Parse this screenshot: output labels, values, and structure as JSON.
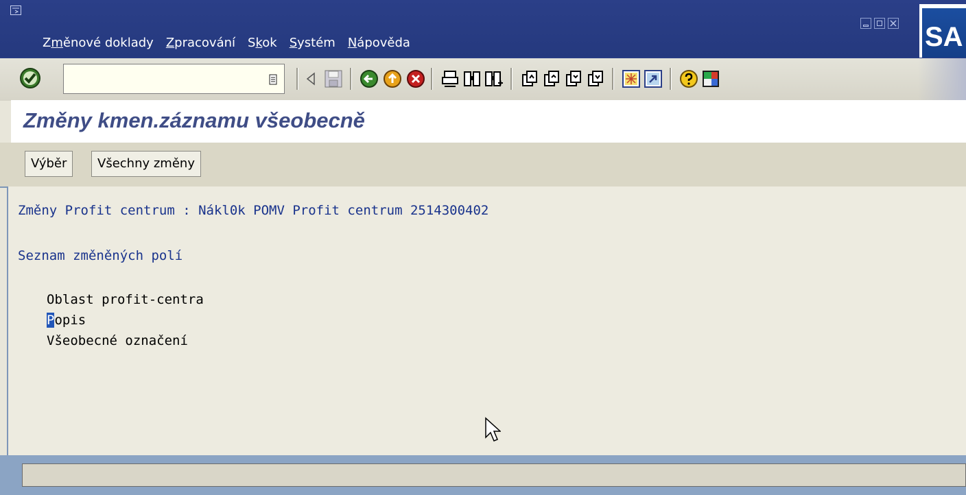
{
  "menubar": {
    "items": [
      {
        "pre": "Z",
        "mn": "m",
        "post": "ěnové doklady"
      },
      {
        "pre": "",
        "mn": "Z",
        "post": "pracování"
      },
      {
        "pre": "S",
        "mn": "k",
        "post": "ok"
      },
      {
        "pre": "",
        "mn": "S",
        "post": "ystém"
      },
      {
        "pre": "",
        "mn": "N",
        "post": "ápověda"
      }
    ],
    "logo": "SA",
    "colors": {
      "background": "#25397e",
      "text": "#ffffff"
    }
  },
  "toolbar": {
    "command_field_value": "",
    "icons": [
      "enter-check-icon",
      "command-history-icon",
      "back-arrow-icon",
      "save-icon",
      "back-icon",
      "exit-icon",
      "cancel-icon",
      "print-icon",
      "find-icon",
      "find-next-icon",
      "first-page-icon",
      "previous-page-icon",
      "next-page-icon",
      "last-page-icon",
      "create-session-icon",
      "shortcut-icon",
      "help-icon",
      "layout-menu-icon"
    ]
  },
  "title": "Změny kmen.záznamu všeobecně",
  "app_toolbar": {
    "buttons": [
      "Výběr",
      "Všechny změny"
    ]
  },
  "content": {
    "header_line": "Změny Profit centrum : Nákl0k POMV Profit centrum 2514300402",
    "list_heading": "Seznam změněných polí",
    "fields": [
      {
        "first": "O",
        "rest": "blast profit-centra"
      },
      {
        "first": "P",
        "rest": "opis"
      },
      {
        "first": "V",
        "rest": "šeobecné označení"
      }
    ],
    "highlighted_field_index": 1
  },
  "status": {
    "message": ""
  }
}
